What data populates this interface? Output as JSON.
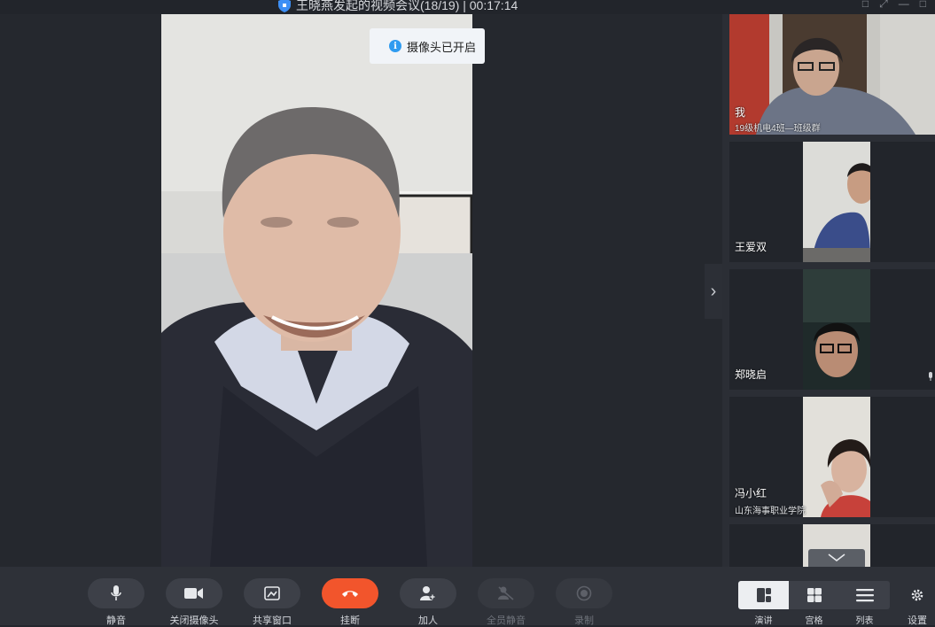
{
  "window": {
    "title": "王晓燕发起的视频会议(18/19) | 00:17:14",
    "controls": [
      "□",
      "⤢",
      "—",
      "□"
    ]
  },
  "toast": {
    "text": "摄像头已开启"
  },
  "participants": [
    {
      "name": "我",
      "subtitle": "19级机电4班—班级群"
    },
    {
      "name": "王爱双",
      "subtitle": ""
    },
    {
      "name": "郑晓启",
      "subtitle": ""
    },
    {
      "name": "冯小红",
      "subtitle": "山东海事职业学院"
    }
  ],
  "toolbar": {
    "mute": "静音",
    "camera_off": "关闭摄像头",
    "share": "共享窗口",
    "hangup": "挂断",
    "add_person": "加人",
    "mute_all": "全员静音",
    "record": "录制",
    "settings": "设置"
  },
  "layouts": {
    "speaker": "演讲",
    "grid": "宫格",
    "list": "列表"
  },
  "colors": {
    "hangup": "#f2552c",
    "accent": "#2f9bf0",
    "background": "#23262d"
  }
}
